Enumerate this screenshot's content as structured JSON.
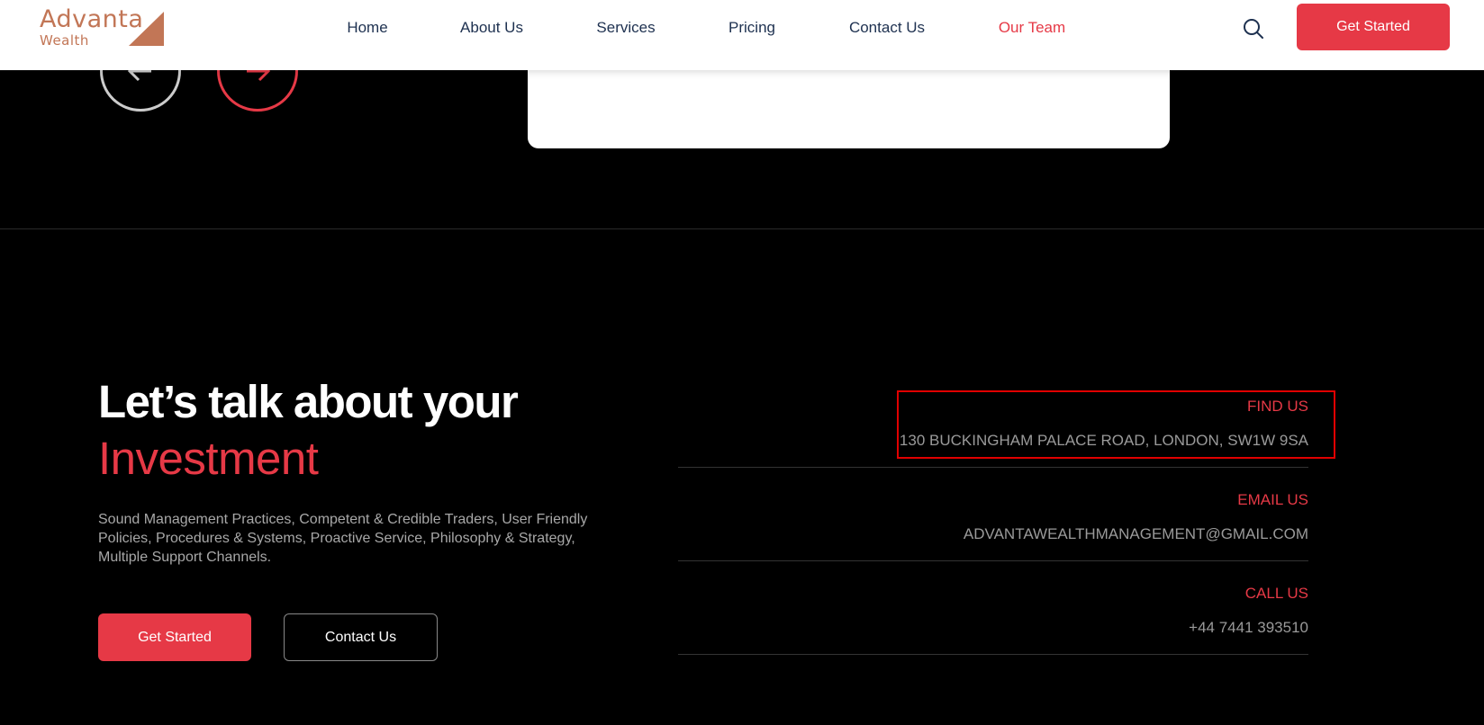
{
  "logo": {
    "line1": "Advanta",
    "line2": "Wealth"
  },
  "nav": {
    "items": [
      "Home",
      "About Us",
      "Services",
      "Pricing",
      "Contact Us",
      "Our Team"
    ],
    "active": "Our Team",
    "cta": "Get Started"
  },
  "hero": {
    "heading_line1": "Let’s talk about your",
    "heading_line2": "Investment",
    "description": "Sound Management Practices, Competent & Credible Traders, User Friendly Policies, Procedures & Systems, Proactive Service, Philosophy & Strategy, Multiple Support Channels.",
    "primary_button": "Get Started",
    "secondary_button": "Contact Us"
  },
  "contact": [
    {
      "label": "FIND US",
      "value": "130 BUCKINGHAM PALACE ROAD, LONDON, SW1W 9SA"
    },
    {
      "label": "EMAIL US",
      "value": "ADVANTAWEALTHMANAGEMENT@GMAIL.COM"
    },
    {
      "label": "CALL US",
      "value": "+44 7441 393510"
    }
  ],
  "colors": {
    "accent": "#e63946",
    "brand": "#c27656",
    "nav_text": "#1e3150"
  }
}
